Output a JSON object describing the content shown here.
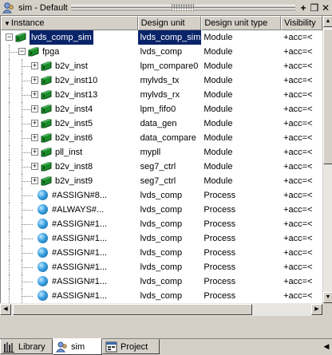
{
  "window": {
    "title": "sim - Default",
    "controls": [
      "+",
      "❒",
      "✕"
    ]
  },
  "columns": [
    "Instance",
    "Design unit",
    "Design unit type",
    "Visibility"
  ],
  "rows": [
    {
      "name": "lvds_comp_sim",
      "unit": "lvds_comp_sim",
      "type": "Module",
      "vis": "+acc=<",
      "kind": "module",
      "level": 0,
      "expander": "-",
      "selected": true
    },
    {
      "name": "fpga",
      "unit": "lvds_comp",
      "type": "Module",
      "vis": "+acc=<",
      "kind": "module",
      "level": 1,
      "expander": "-"
    },
    {
      "name": "b2v_inst",
      "unit": "lpm_compare0",
      "type": "Module",
      "vis": "+acc=<",
      "kind": "module",
      "level": 2,
      "expander": "+"
    },
    {
      "name": "b2v_inst10",
      "unit": "mylvds_tx",
      "type": "Module",
      "vis": "+acc=<",
      "kind": "module",
      "level": 2,
      "expander": "+"
    },
    {
      "name": "b2v_inst13",
      "unit": "mylvds_rx",
      "type": "Module",
      "vis": "+acc=<",
      "kind": "module",
      "level": 2,
      "expander": "+"
    },
    {
      "name": "b2v_inst4",
      "unit": "lpm_fifo0",
      "type": "Module",
      "vis": "+acc=<",
      "kind": "module",
      "level": 2,
      "expander": "+"
    },
    {
      "name": "b2v_inst5",
      "unit": "data_gen",
      "type": "Module",
      "vis": "+acc=<",
      "kind": "module",
      "level": 2,
      "expander": "+"
    },
    {
      "name": "b2v_inst6",
      "unit": "data_compare",
      "type": "Module",
      "vis": "+acc=<",
      "kind": "module",
      "level": 2,
      "expander": "+"
    },
    {
      "name": "pll_inst",
      "unit": "mypll",
      "type": "Module",
      "vis": "+acc=<",
      "kind": "module",
      "level": 2,
      "expander": "+"
    },
    {
      "name": "b2v_inst8",
      "unit": "seg7_ctrl",
      "type": "Module",
      "vis": "+acc=<",
      "kind": "module",
      "level": 2,
      "expander": "+"
    },
    {
      "name": "b2v_inst9",
      "unit": "seg7_ctrl",
      "type": "Module",
      "vis": "+acc=<",
      "kind": "module",
      "level": 2,
      "expander": "+"
    },
    {
      "name": "#ASSIGN#8...",
      "unit": "lvds_comp",
      "type": "Process",
      "vis": "+acc=<",
      "kind": "process",
      "level": 2,
      "expander": ""
    },
    {
      "name": "#ALWAYS#...",
      "unit": "lvds_comp",
      "type": "Process",
      "vis": "+acc=<",
      "kind": "process",
      "level": 2,
      "expander": ""
    },
    {
      "name": "#ASSIGN#1...",
      "unit": "lvds_comp",
      "type": "Process",
      "vis": "+acc=<",
      "kind": "process",
      "level": 2,
      "expander": ""
    },
    {
      "name": "#ASSIGN#1...",
      "unit": "lvds_comp",
      "type": "Process",
      "vis": "+acc=<",
      "kind": "process",
      "level": 2,
      "expander": ""
    },
    {
      "name": "#ASSIGN#1...",
      "unit": "lvds_comp",
      "type": "Process",
      "vis": "+acc=<",
      "kind": "process",
      "level": 2,
      "expander": ""
    },
    {
      "name": "#ASSIGN#1...",
      "unit": "lvds_comp",
      "type": "Process",
      "vis": "+acc=<",
      "kind": "process",
      "level": 2,
      "expander": ""
    },
    {
      "name": "#ASSIGN#1...",
      "unit": "lvds_comp",
      "type": "Process",
      "vis": "+acc=<",
      "kind": "process",
      "level": 2,
      "expander": ""
    },
    {
      "name": "#ASSIGN#1...",
      "unit": "lvds_comp",
      "type": "Process",
      "vis": "+acc=<",
      "kind": "process",
      "level": 2,
      "expander": ""
    }
  ],
  "tabs": [
    {
      "label": "Library",
      "icon": "library-icon",
      "active": false
    },
    {
      "label": "sim",
      "icon": "sim-icon",
      "active": true
    },
    {
      "label": "Project",
      "icon": "project-icon",
      "active": false
    }
  ],
  "colors": {
    "selection": "#0a246a",
    "module_icon": "#1a8a2a",
    "process_icon": "#3aa0e0"
  }
}
